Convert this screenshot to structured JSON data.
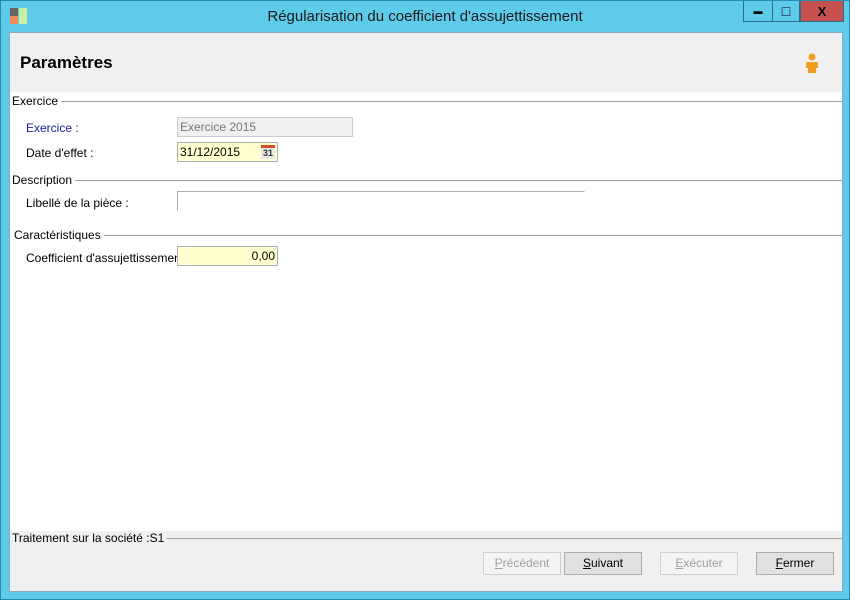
{
  "window": {
    "title": "Régularisation du coefficient d'assujettissement",
    "minimize": "▬",
    "maximize": "□",
    "close": "X"
  },
  "header": {
    "title": "Paramètres"
  },
  "sections": {
    "exercice": {
      "title": "Exercice",
      "exercice_label": "Exercice :",
      "exercice_value": "Exercice 2015",
      "date_label": "Date d'effet :",
      "date_value": "31/12/2015",
      "calendar_day": "31"
    },
    "description": {
      "title": "Description",
      "libelle_label": "Libellé de la pièce :",
      "libelle_value": ""
    },
    "caracteristiques": {
      "title": "Caractéristiques",
      "coef_label": "Coefficient d'assujettissement :",
      "coef_value": "0,00"
    }
  },
  "footer": {
    "status": "Traitement sur la société :S1",
    "buttons": {
      "prev": {
        "first": "P",
        "rest": "récédent"
      },
      "next": {
        "first": "S",
        "rest": "uivant"
      },
      "exec": {
        "first": "E",
        "rest": "xécuter"
      },
      "close": {
        "first": "F",
        "rest": "ermer"
      }
    }
  }
}
